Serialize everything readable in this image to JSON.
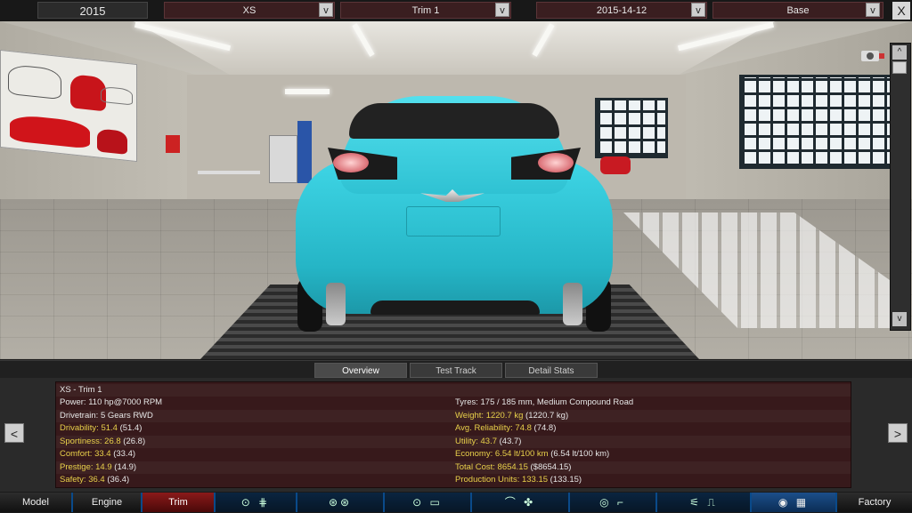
{
  "topbar": {
    "year": "2015",
    "model": "XS",
    "trim": "Trim 1",
    "date": "2015-14-12",
    "variant": "Base",
    "dropdown_label": "v",
    "close_label": "X"
  },
  "scene": {
    "scroll_up": "^",
    "scroll_down": "v"
  },
  "tabs": [
    "Overview",
    "Test Track",
    "Detail Stats"
  ],
  "info": {
    "title": "XS - Trim 1",
    "left": [
      {
        "label": "Power: ",
        "value": "110 hp@7000 RPM",
        "highlight": false
      },
      {
        "label": "Drivetrain: ",
        "value": "5 Gears RWD",
        "highlight": false
      },
      {
        "label": "Drivability: ",
        "value": "51.4",
        "extra": " (51.4)",
        "highlight": true
      },
      {
        "label": "Sportiness: ",
        "value": "26.8",
        "extra": " (26.8)",
        "highlight": true
      },
      {
        "label": "Comfort: ",
        "value": "33.4",
        "extra": " (33.4)",
        "highlight": true
      },
      {
        "label": "Prestige: ",
        "value": "14.9",
        "extra": " (14.9)",
        "highlight": true
      },
      {
        "label": "Safety: ",
        "value": "36.4",
        "extra": " (36.4)",
        "highlight": true
      }
    ],
    "right": [
      {
        "label": "Tyres: ",
        "value": "175 / 185 mm, Medium Compound Road",
        "highlight": false
      },
      {
        "label": "Weight: ",
        "value": "1220.7 kg",
        "extra": " (1220.7 kg)",
        "highlight": true
      },
      {
        "label": "Avg. Reliability: ",
        "value": "74.8",
        "extra": " (74.8)",
        "highlight": true
      },
      {
        "label": "Utility: ",
        "value": "43.7",
        "extra": " (43.7)",
        "highlight": true
      },
      {
        "label": "Economy: ",
        "value": "6.54 lt/100 km",
        "extra": " (6.54 lt/100 km)",
        "highlight": true
      },
      {
        "label": "Total Cost: ",
        "value": "8654.15",
        "extra": " ($8654.15)",
        "highlight": true
      },
      {
        "label": "Production Units: ",
        "value": "133.15",
        "extra": " (133.15)",
        "highlight": true
      }
    ],
    "prev": "<",
    "next": ">"
  },
  "nav": {
    "model": "Model",
    "engine": "Engine",
    "trim": "Trim",
    "factory": "Factory",
    "icons": [
      "chassis-gearbox",
      "wheels",
      "suspension-body",
      "car-aero",
      "interior",
      "springs",
      "test-flag"
    ]
  },
  "colors": {
    "car": "#2fc6d6",
    "accent": "#e8d04a",
    "active_tab": "#8a1a1a",
    "panel": "#37191b"
  }
}
